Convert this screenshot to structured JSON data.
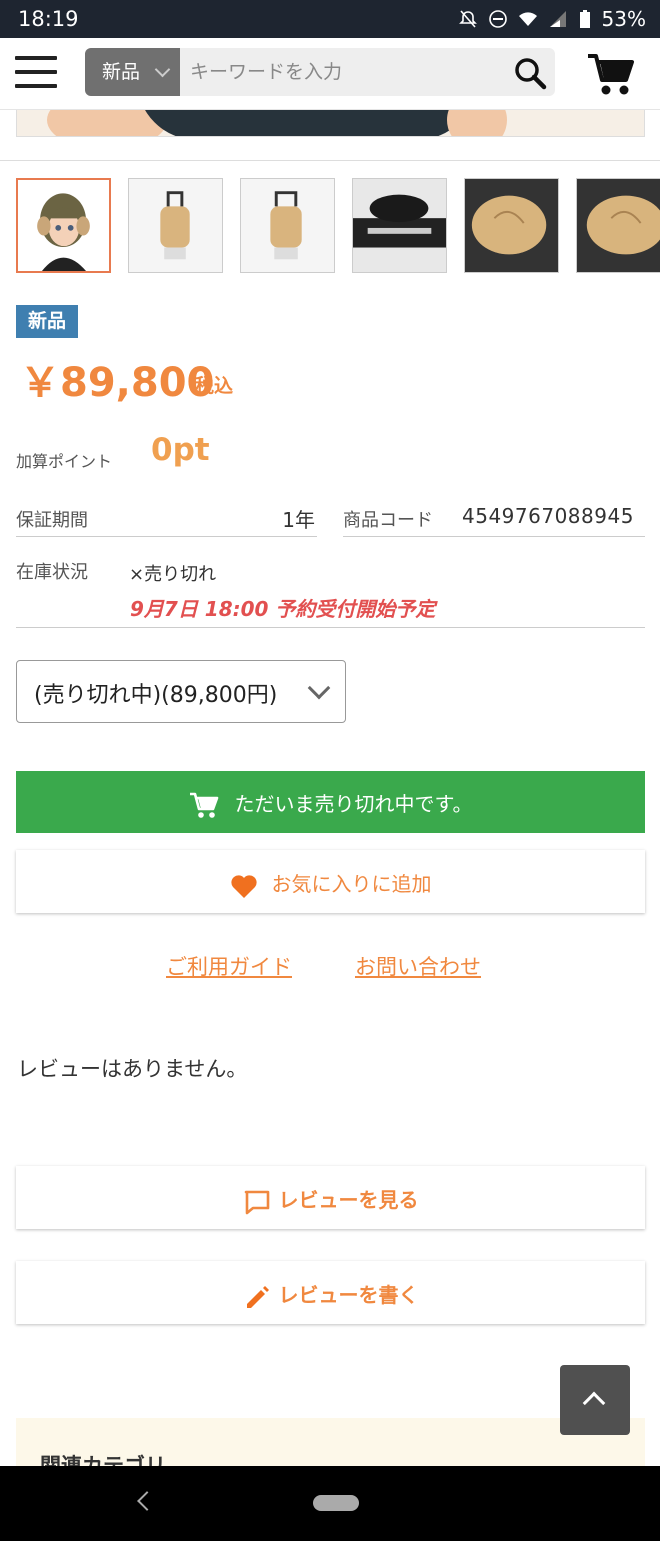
{
  "status_bar": {
    "time": "18:19",
    "battery": "53%"
  },
  "header": {
    "category": "新品",
    "search_placeholder": "キーワードを入力"
  },
  "product": {
    "badge": "新品",
    "price": "￥89,800",
    "tax_label": "税込",
    "points_label": "加算ポイント",
    "points_value": "0pt",
    "warranty_label": "保証期間",
    "warranty_value": "1年",
    "code_label": "商品コード",
    "code_value": "4549767088945",
    "stock_label": "在庫状況",
    "stock_value": "×売り切れ",
    "stock_note": "9月7日 18:00 予約受付開始予定",
    "variant_selected": "(売り切れ中)(89,800円)"
  },
  "actions": {
    "soldout_label": "ただいま売り切れ中です。",
    "favorite_label": "お気に入りに追加",
    "guide_link": "ご利用ガイド",
    "contact_link": "お問い合わせ"
  },
  "reviews": {
    "empty_text": "レビューはありません。",
    "view_label": "レビューを見る",
    "write_label": "レビューを書く"
  },
  "related": {
    "title": "関連カテゴリ"
  },
  "icons": {
    "menu": "hamburger-menu-icon",
    "search": "search-icon",
    "cart": "cart-icon",
    "heart": "heart-icon",
    "comment": "comment-icon",
    "pencil": "pencil-icon"
  },
  "colors": {
    "accent_orange": "#f0883f",
    "soldout_green": "#3aa94c",
    "badge_blue": "#3f7fb0",
    "note_red": "#e25050"
  }
}
